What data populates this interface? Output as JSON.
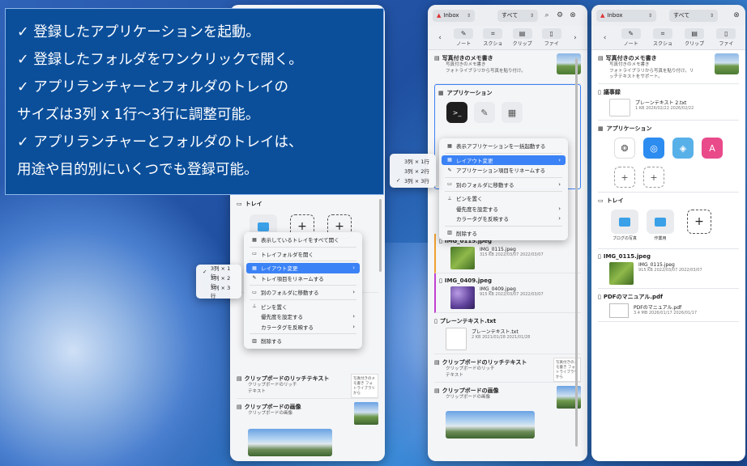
{
  "caption": {
    "lines": [
      "✓ 登録したアプリケーションを起動。",
      "✓ 登録したフォルダをワンクリックで開く。",
      "✓ アプリランチャーとフォルダのトレイの",
      "サイズは3列 x 1行〜3行に調整可能。",
      "✓ アプリランチャーとフォルダのトレイは、",
      "用途や目的別にいくつでも登録可能。"
    ]
  },
  "header": {
    "inbox": "Inbox",
    "filter": "すべて"
  },
  "toolbar": {
    "items": [
      "ノート",
      "スクショ",
      "クリップ",
      "ファイ"
    ]
  },
  "win1": {
    "tray_title": "トレイ",
    "menu": [
      "表示しているトレイをすべて開く",
      "トレイフォルダを開く",
      "レイアウト変更",
      "トレイ項目をリネームする",
      "別のフォルダに移動する",
      "ピンを置く",
      "優先度を設定する",
      "カラータグを反映する",
      "削除する"
    ],
    "submenu": [
      "3列 × 1行",
      "3列 × 2行",
      "3列 × 3行"
    ],
    "rich_title": "クリップボードのリッチテキスト",
    "rich_sub": "クリップボードのリッチ\nテキスト",
    "rich_thumb": "写真付きのメモ書き フォトライブラリから",
    "img_title": "クリップボードの画像",
    "img_sub": "クリップボードの画像"
  },
  "win2": {
    "memo_title": "写真付きのメモ書き",
    "memo_sub": "写真付きのメモ書き\nフォトライブラリから写真を貼り付け。",
    "apps_title": "アプリケーション",
    "menu": [
      "表示アプリケーションを一括起動する",
      "レイアウト変更",
      "アプリケーション項目をリネームする",
      "別のフォルダに移動する",
      "ピンを置く",
      "優先度を設定する",
      "カラータグを反映する",
      "削除する"
    ],
    "submenu": [
      "3列 × 1行",
      "3列 × 2行",
      "3列 × 3行"
    ],
    "img1_title": "IMG_0115.jpeg",
    "img1_file": "IMG_0115.jpeg",
    "img1_meta": "315 KB  2022/03/07  2022/03/07",
    "img2_title": "IMG_0409.jpeg",
    "img2_file": "IMG_0409.jpeg",
    "img2_meta": "915 KB  2022/03/07  2022/03/07",
    "txt_title": "プレーンテキスト.txt",
    "txt_file": "プレーンテキスト.txt",
    "txt_meta": "2 KB  2021/01/28  2021/01/28",
    "rich_title": "クリップボードのリッチテキスト",
    "rich_sub": "クリップボードのリッチ\nテキスト",
    "rich_thumb": "写真付きのメモ書き フォトライブラリから",
    "img_title": "クリップボードの画像",
    "img_sub": "クリップボードの画像"
  },
  "win3": {
    "memo_title": "写真付きのメモ書き",
    "memo_sub": "写真付きのメモ書き\nフォトライブラリから写真を貼り付け。リ\nッチテキストをサポート。",
    "rec_title": "議事録",
    "rec_file": "プレーンテキスト 2.txt",
    "rec_meta": "1 KB  2026/02/22  2026/02/22",
    "apps_title": "アプリケーション",
    "tray_title": "トレイ",
    "folders": [
      "ブログの写真",
      "作業用"
    ],
    "img_title": "IMG_0115.jpeg",
    "img_file": "IMG_0115.jpeg",
    "img_meta": "915 KB  2022/03/07  2022/03/07",
    "pdf_title": "PDFのマニュアル.pdf",
    "pdf_file": "PDFのマニュアル.pdf",
    "pdf_meta": "3.4 MB  2026/01/17  2026/01/17"
  }
}
